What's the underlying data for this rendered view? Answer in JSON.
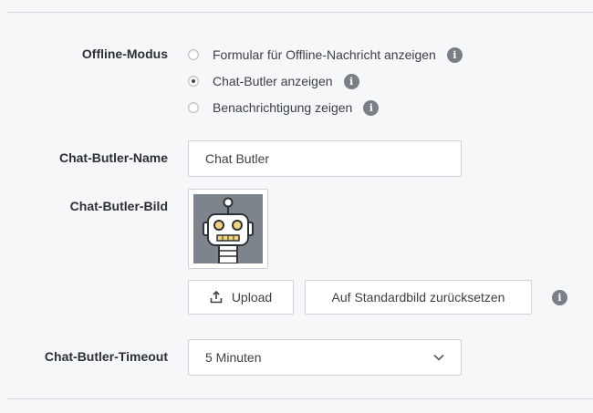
{
  "offline_mode": {
    "label": "Offline-Modus",
    "options": [
      {
        "label": "Formular für Offline-Nachricht anzeigen",
        "checked": false
      },
      {
        "label": "Chat-Butler anzeigen",
        "checked": true
      },
      {
        "label": "Benachrichtigung zeigen",
        "checked": false
      }
    ]
  },
  "butler_name": {
    "label": "Chat-Butler-Name",
    "value": "Chat Butler"
  },
  "butler_image": {
    "label": "Chat-Butler-Bild",
    "upload_label": "Upload",
    "reset_label": "Auf Standardbild zurücksetzen"
  },
  "butler_timeout": {
    "label": "Chat-Butler-Timeout",
    "value": "5 Minuten"
  },
  "icons": {
    "info": "info-icon",
    "upload": "upload-icon",
    "chevron": "chevron-down-icon",
    "robot": "robot-avatar"
  },
  "colors": {
    "background": "#f6f7f9",
    "info_badge": "#7a7f87",
    "avatar_bg": "#7e848c",
    "robot_eye": "#f0d37a"
  }
}
